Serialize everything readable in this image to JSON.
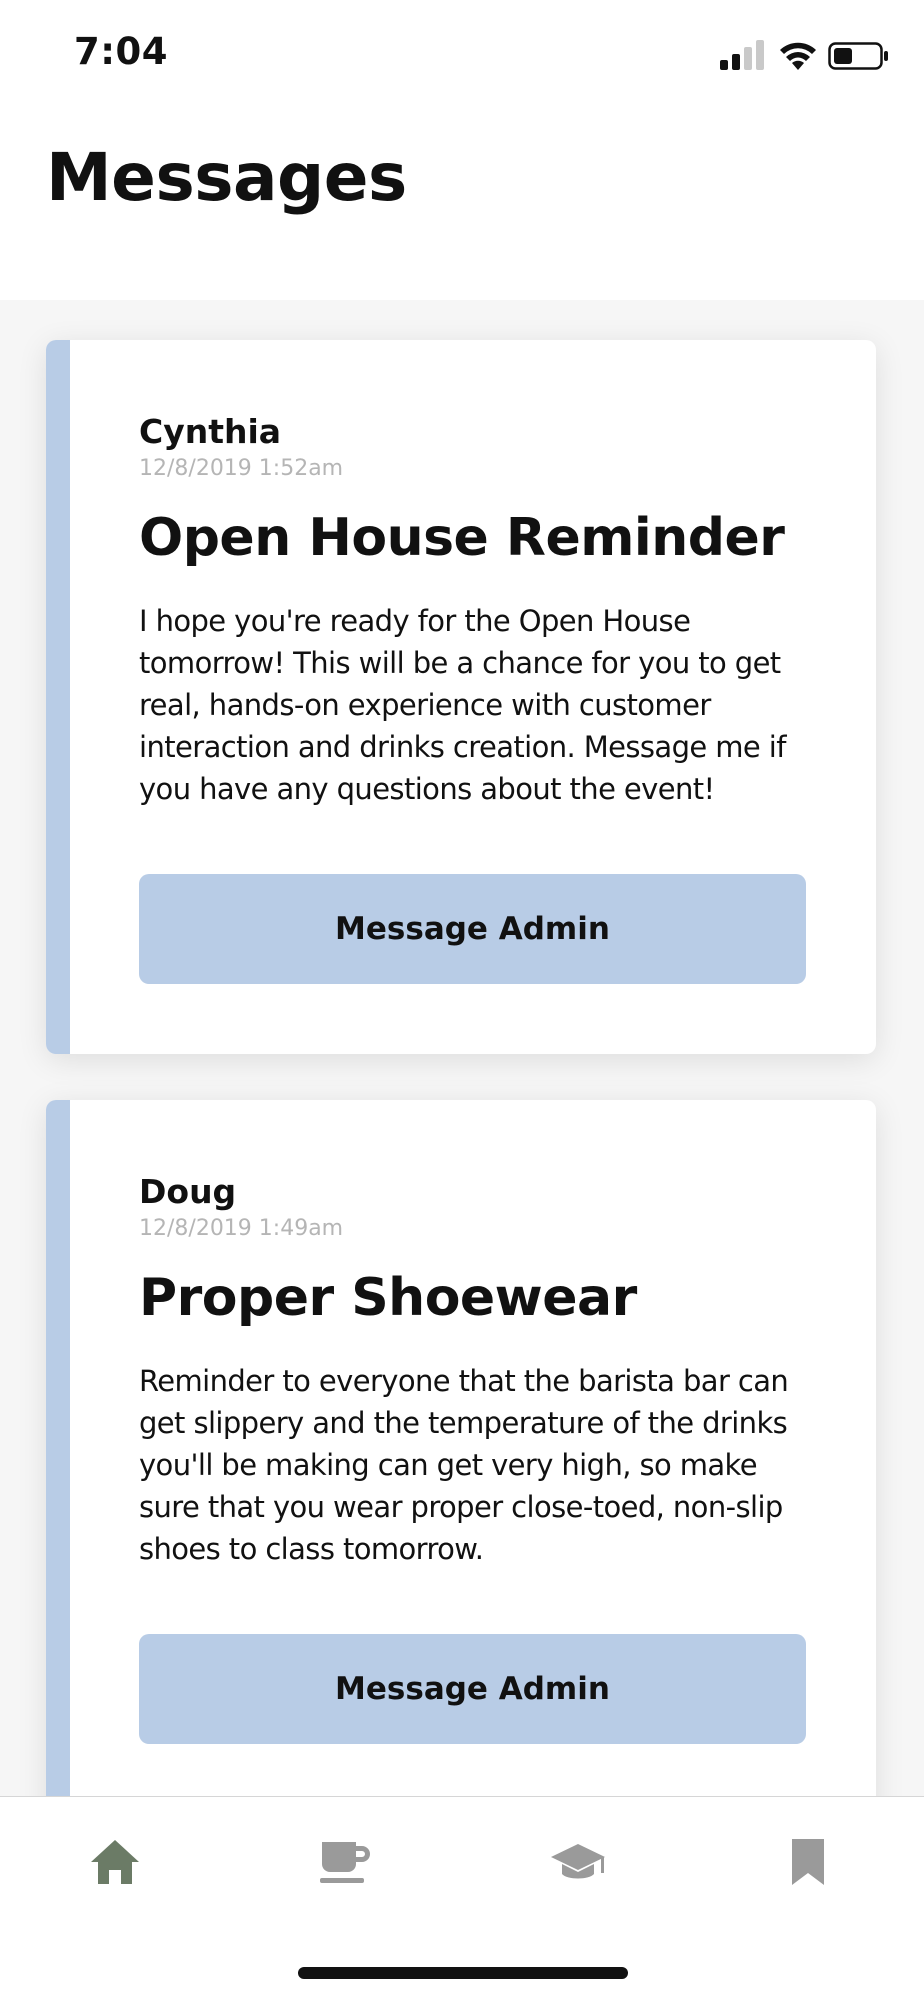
{
  "status_bar": {
    "time": "7:04",
    "icons": [
      "signal-icon",
      "wifi-icon",
      "battery-icon"
    ]
  },
  "page": {
    "title": "Messages"
  },
  "messages": [
    {
      "sender": "Cynthia",
      "timestamp": "12/8/2019 1:52am",
      "title": "Open House Reminder",
      "body": "I hope you're ready for the Open House tomorrow! This will be a chance for you to get real, hands-on experience with customer interaction and drinks creation. Message me if you have any questions about the event!",
      "button_label": "Message Admin"
    },
    {
      "sender": "Doug",
      "timestamp": "12/8/2019 1:49am",
      "title": "Proper Shoewear",
      "body": "Reminder to everyone that the barista bar can get slippery and the temperature of the drinks you'll be making can get very high, so make sure that you wear proper close-toed, non-slip shoes to class tomorrow.",
      "button_label": "Message Admin"
    }
  ],
  "tab_bar": {
    "tabs": [
      {
        "icon": "home-icon",
        "active": true
      },
      {
        "icon": "coffee-cup-icon",
        "active": false
      },
      {
        "icon": "graduation-cap-icon",
        "active": false
      },
      {
        "icon": "bookmark-icon",
        "active": false
      }
    ]
  },
  "colors": {
    "accent": "#b8cce6",
    "tab_active": "#6b7b66",
    "tab_inactive": "#9a9a9a",
    "timestamp": "#b5b5b5"
  }
}
